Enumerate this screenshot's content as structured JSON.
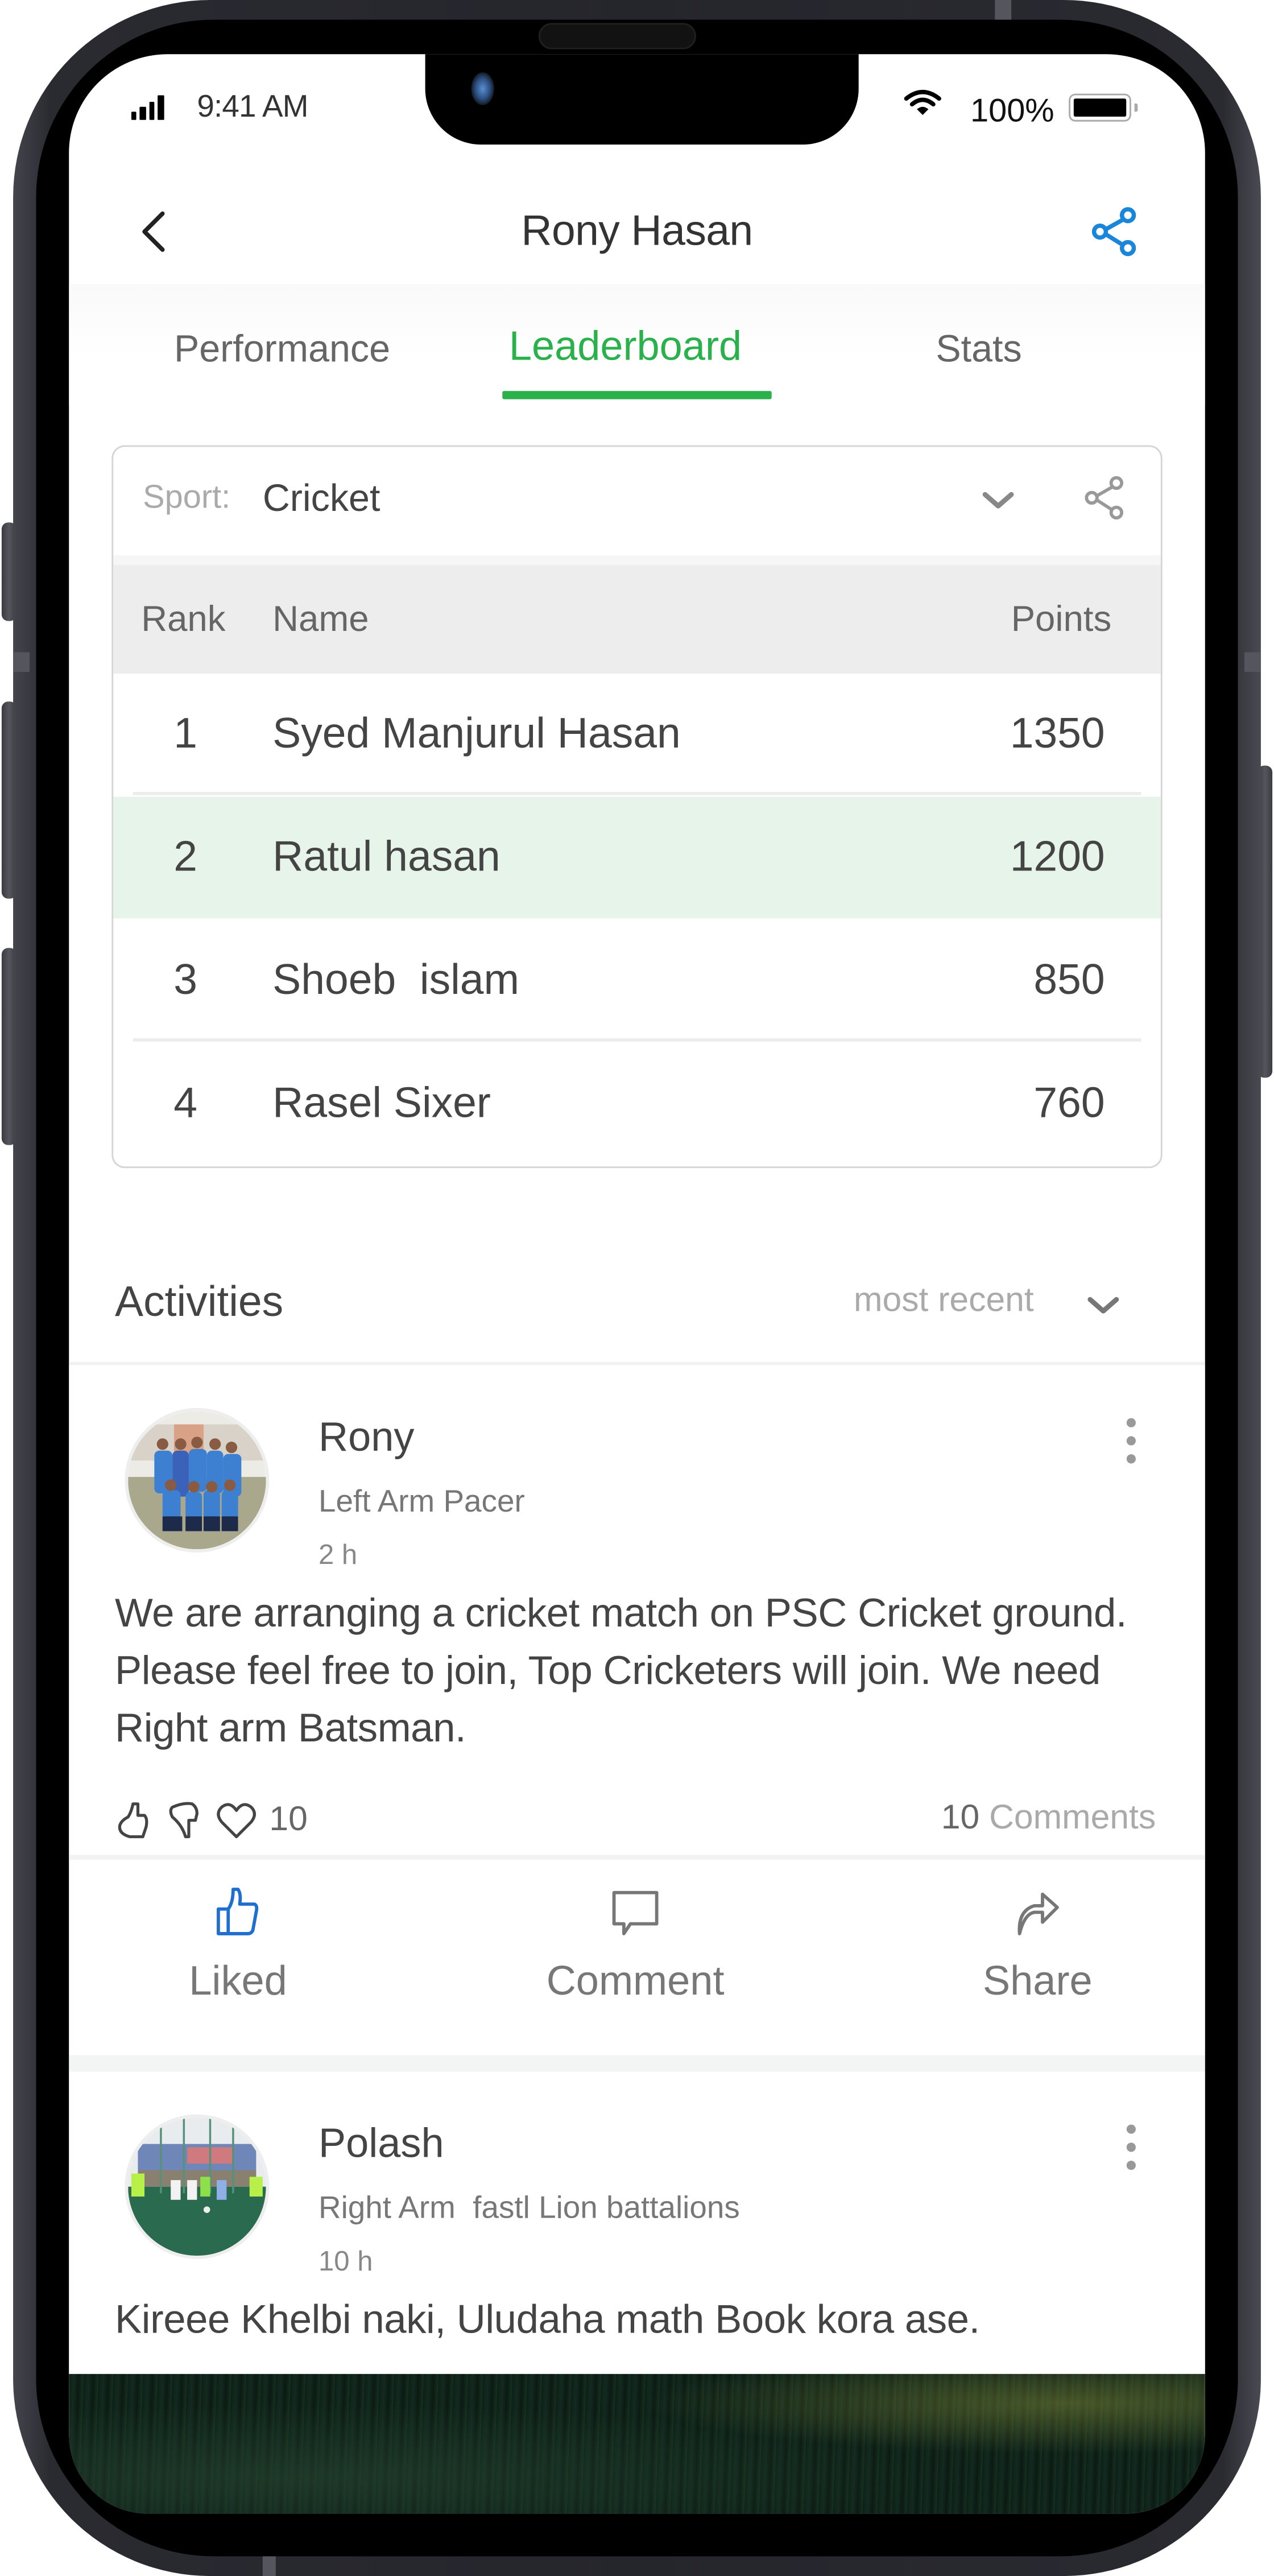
{
  "status_bar": {
    "time": "9:41 AM",
    "battery_percent": "100%",
    "battery_level": 1.0,
    "signal_icon": "cellular-signal-icon",
    "wifi_icon": "wifi-icon"
  },
  "header": {
    "title": "Rony Hasan",
    "back_icon": "chevron-left-icon",
    "share_icon": "share-icon",
    "accent_color": "#1a86d9"
  },
  "tabs": {
    "active_color": "#2ab14c",
    "items": [
      {
        "label": "Performance",
        "active": false
      },
      {
        "label": "Leaderboard",
        "active": true
      },
      {
        "label": "Stats",
        "active": false
      }
    ]
  },
  "leaderboard": {
    "sport_label": "Sport:",
    "sport_value": "Cricket",
    "dropdown_icon": "chevron-down-icon",
    "share_icon": "share-icon",
    "columns": {
      "rank": "Rank",
      "name": "Name",
      "points": "Points"
    },
    "highlight_color": "#e6f4ea",
    "rows": [
      {
        "rank": "1",
        "name": "Syed Manjurul Hasan",
        "points": "1350",
        "highlighted": false
      },
      {
        "rank": "2",
        "name": "Ratul hasan",
        "points": "1200",
        "highlighted": true
      },
      {
        "rank": "3",
        "name": "Shoeb  islam",
        "points": "850",
        "highlighted": false
      },
      {
        "rank": "4",
        "name": "Rasel Sixer",
        "points": "760",
        "highlighted": false
      }
    ]
  },
  "activities": {
    "title": "Activities",
    "sort_label": "most recent",
    "sort_icon": "chevron-down-icon",
    "posts": [
      {
        "author": "Rony",
        "role": "Left Arm Pacer",
        "time_ago": "2 h",
        "avatar": "team-photo-avatar",
        "body": "We are arranging a cricket match on PSC Cricket ground. Please feel free to join, Top Cricketers will join. We need Right arm Batsman.",
        "reaction_count": "10",
        "comments_count": "10",
        "comments_label": "Comments",
        "actions": [
          {
            "label": "Liked",
            "icon": "thumbs-up-icon",
            "active": true
          },
          {
            "label": "Comment",
            "icon": "comment-icon",
            "active": false
          },
          {
            "label": "Share",
            "icon": "share-arrow-icon",
            "active": false
          }
        ]
      },
      {
        "author": "Polash",
        "role": "Right Arm  fastl Lion battalions",
        "time_ago": "10 h",
        "avatar": "football-field-avatar",
        "body": "Kireee Khelbi naki, Uludaha math Book kora ase."
      }
    ]
  }
}
